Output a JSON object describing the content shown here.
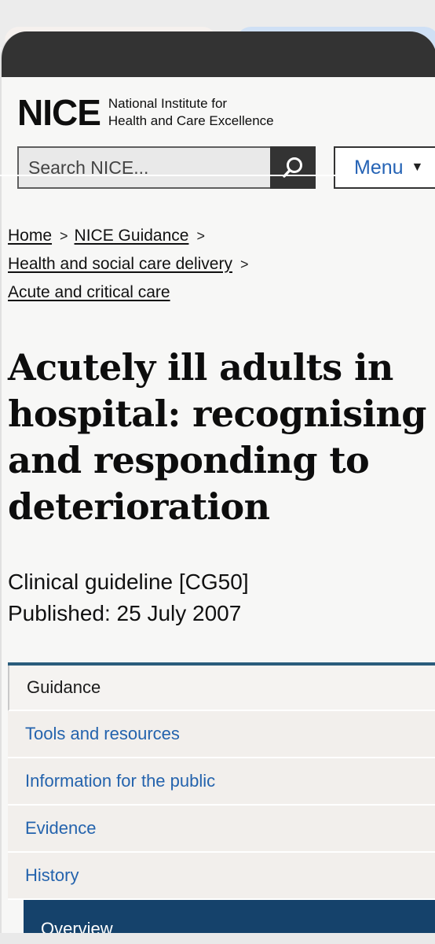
{
  "header": {
    "logo_mark": "NICE",
    "logo_line1": "National Institute for",
    "logo_line2": "Health and Care Excellence",
    "search_placeholder": "Search NICE...",
    "menu_label": "Menu",
    "menu_caret": "▼"
  },
  "breadcrumbs": [
    {
      "label": "Home"
    },
    {
      "label": "NICE Guidance"
    },
    {
      "label": "Health and social care delivery"
    },
    {
      "label": "Acute and critical care"
    }
  ],
  "breadcrumb_separator": ">",
  "title": "Acutely ill adults in hospital: recognising and responding to deterioration",
  "meta": {
    "guideline_type": "Clinical guideline [CG50]",
    "published": "Published: 25 July 2007"
  },
  "tabs": [
    {
      "label": "Guidance",
      "active": true
    },
    {
      "label": "Tools and resources"
    },
    {
      "label": "Information for the public"
    },
    {
      "label": "Evidence"
    },
    {
      "label": "History"
    }
  ],
  "subnav": {
    "label": "Overview"
  },
  "colors": {
    "link_blue": "#2463ad",
    "nav_dark": "#15426b",
    "accent_bar": "#2a5c7c",
    "search_button": "#333333"
  }
}
